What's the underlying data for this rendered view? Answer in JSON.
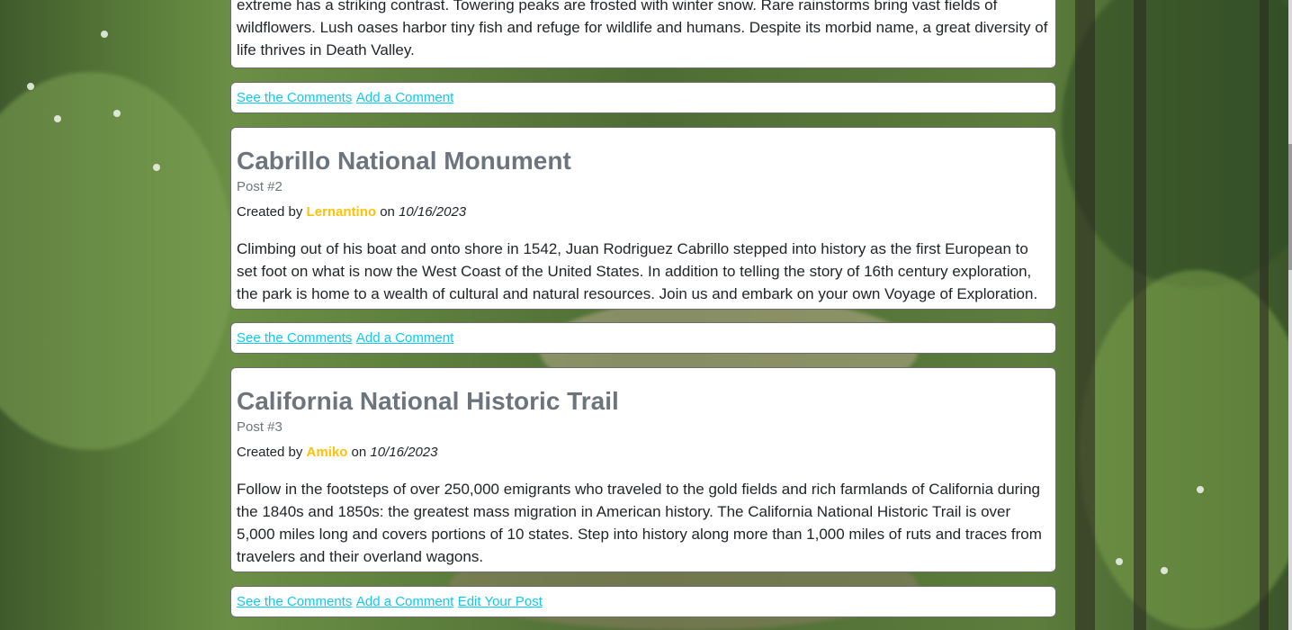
{
  "colors": {
    "link": "#0dcaf0",
    "author": "#ffc107",
    "muted": "#6c757d",
    "text": "#212529"
  },
  "posts": [
    {
      "body": "extreme has a striking contrast. Towering peaks are frosted with winter snow. Rare rainstorms bring vast fields of wildflowers. Lush oases harbor tiny fish and refuge for wildlife and humans. Despite its morbid name, a great diversity of life thrives in Death Valley.",
      "links": {
        "see": "See the Comments",
        "add": "Add a Comment"
      }
    },
    {
      "title": "Cabrillo National Monument",
      "post_number": "Post #2",
      "created_prefix": "Created by ",
      "author": "Lernantino",
      "on": " on ",
      "date": "10/16/2023",
      "body": "Climbing out of his boat and onto shore in 1542, Juan Rodriguez Cabrillo stepped into history as the first European to set foot on what is now the West Coast of the United States. In addition to telling the story of 16th century exploration, the park is home to a wealth of cultural and natural resources. Join us and embark on your own Voyage of Exploration.",
      "links": {
        "see": "See the Comments",
        "add": "Add a Comment"
      }
    },
    {
      "title": "California National Historic Trail",
      "post_number": "Post #3",
      "created_prefix": "Created by ",
      "author": "Amiko",
      "on": " on ",
      "date": "10/16/2023",
      "body": "Follow in the footsteps of over 250,000 emigrants who traveled to the gold fields and rich farmlands of California during the 1840s and 1850s: the greatest mass migration in American history. The California National Historic Trail is over 5,000 miles long and covers portions of 10 states. Step into history along more than 1,000 miles of ruts and traces from travelers and their overland wagons.",
      "links": {
        "see": "See the Comments",
        "add": "Add a Comment",
        "edit": "Edit Your Post"
      }
    }
  ]
}
